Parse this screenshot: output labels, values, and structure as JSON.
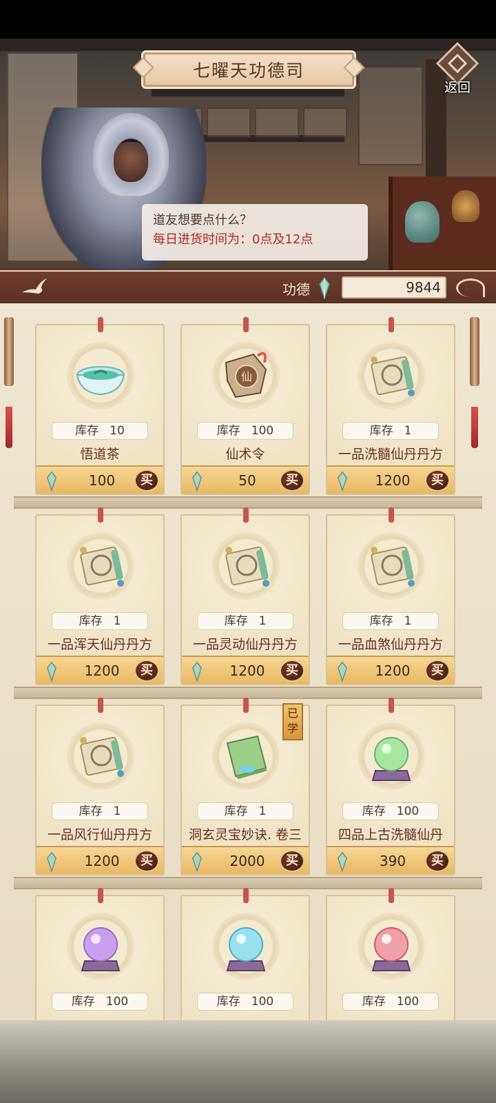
{
  "header": {
    "title": "七曜天功德司",
    "back_label": "返回"
  },
  "dialog": {
    "line1": "道友想要点什么？",
    "line2": "每日进货时间为：0点及12点"
  },
  "merit": {
    "label": "功德",
    "value": "9844"
  },
  "shop": {
    "stock_label": "库存",
    "buy_label": "买",
    "learned_label": "已学",
    "items": [
      {
        "name": "悟道茶",
        "stock": "10",
        "price": "100",
        "icon": "tea-bowl-icon"
      },
      {
        "name": "仙术令",
        "stock": "100",
        "price": "50",
        "icon": "token-icon"
      },
      {
        "name": "一品洗髓仙丹丹方",
        "stock": "1",
        "price": "1200",
        "icon": "scroll-icon"
      },
      {
        "name": "一品浑天仙丹丹方",
        "stock": "1",
        "price": "1200",
        "icon": "scroll-icon"
      },
      {
        "name": "一品灵动仙丹丹方",
        "stock": "1",
        "price": "1200",
        "icon": "scroll-icon"
      },
      {
        "name": "一品血煞仙丹丹方",
        "stock": "1",
        "price": "1200",
        "icon": "scroll-icon"
      },
      {
        "name": "一品风行仙丹丹方",
        "stock": "1",
        "price": "1200",
        "icon": "scroll-icon"
      },
      {
        "name": "洞玄灵宝妙诀. 卷三",
        "stock": "1",
        "price": "2000",
        "icon": "book-icon",
        "learned": true
      },
      {
        "name": "四品上古洗髓仙丹",
        "stock": "100",
        "price": "390",
        "icon": "green-orb-icon"
      },
      {
        "name": "",
        "stock": "100",
        "price": "",
        "icon": "purple-orb-icon"
      },
      {
        "name": "",
        "stock": "100",
        "price": "",
        "icon": "cyan-orb-icon"
      },
      {
        "name": "",
        "stock": "100",
        "price": "",
        "icon": "red-orb-icon"
      }
    ]
  },
  "colors": {
    "title_text": "#5a3224",
    "dialog_highlight": "#b02a1c",
    "item_name": "#6a2e22",
    "price_bar": "#e9b862",
    "merit_bar": "#6e3d2f"
  }
}
